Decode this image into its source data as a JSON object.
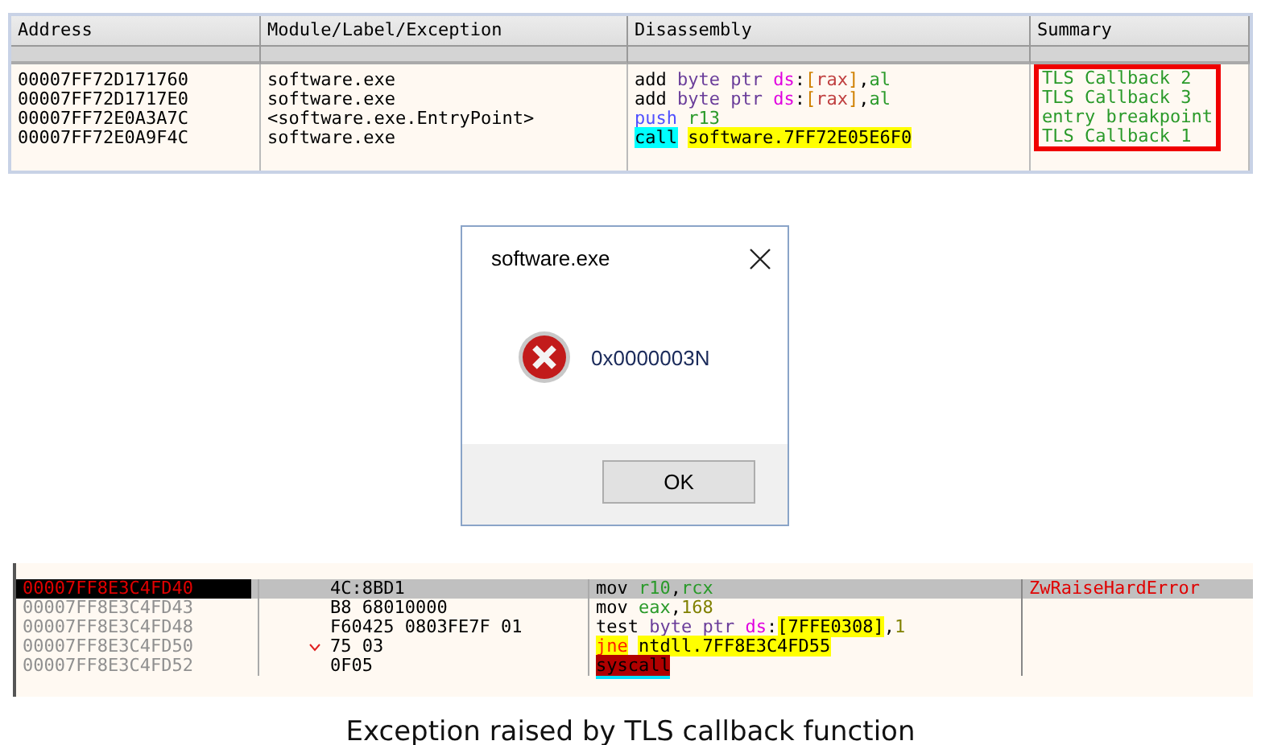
{
  "top_table": {
    "columns": [
      "Address",
      "Module/Label/Exception",
      "Disassembly",
      "Summary"
    ],
    "summary_highlighted": true,
    "rows": [
      {
        "address": "00007FF72D171760",
        "module": "software.exe",
        "disassembly": [
          {
            "text": "add ",
            "kind": "op"
          },
          {
            "text": "byte ptr ",
            "kind": "size"
          },
          {
            "text": "ds",
            "kind": "seg"
          },
          {
            "text": ":",
            "kind": "punct"
          },
          {
            "text": "[",
            "kind": "bracket"
          },
          {
            "text": "rax",
            "kind": "memreg"
          },
          {
            "text": "]",
            "kind": "bracket"
          },
          {
            "text": ",",
            "kind": "punct"
          },
          {
            "text": "al",
            "kind": "reg"
          }
        ],
        "summary": "TLS Callback 2"
      },
      {
        "address": "00007FF72D1717E0",
        "module": "software.exe",
        "disassembly": [
          {
            "text": "add ",
            "kind": "op"
          },
          {
            "text": "byte ptr ",
            "kind": "size"
          },
          {
            "text": "ds",
            "kind": "seg"
          },
          {
            "text": ":",
            "kind": "punct"
          },
          {
            "text": "[",
            "kind": "bracket"
          },
          {
            "text": "rax",
            "kind": "memreg"
          },
          {
            "text": "]",
            "kind": "bracket"
          },
          {
            "text": ",",
            "kind": "punct"
          },
          {
            "text": "al",
            "kind": "reg"
          }
        ],
        "summary": "TLS Callback 3"
      },
      {
        "address": "00007FF72E0A3A7C",
        "module": "<software.exe.EntryPoint>",
        "disassembly": [
          {
            "text": "push ",
            "kind": "stack"
          },
          {
            "text": "r13",
            "kind": "reg"
          }
        ],
        "summary": "entry breakpoint"
      },
      {
        "address": "00007FF72E0A9F4C",
        "module": "software.exe",
        "disassembly": [
          {
            "text": "call",
            "kind": "call"
          },
          {
            "text": "software.7FF72E05E6F0",
            "kind": "target"
          }
        ],
        "summary": "TLS Callback 1"
      }
    ]
  },
  "dialog": {
    "title": "software.exe",
    "message": "0x0000003N",
    "button": "OK"
  },
  "trace": {
    "rows": [
      {
        "address": "00007FF8E3C4FD40",
        "selected": true,
        "branch": false,
        "bytes": "4C:8BD1",
        "disassembly": [
          {
            "text": "mov ",
            "kind": "op"
          },
          {
            "text": "r10",
            "kind": "reg"
          },
          {
            "text": ",",
            "kind": "punct"
          },
          {
            "text": "rcx",
            "kind": "reg"
          }
        ],
        "comment": "ZwRaiseHardError"
      },
      {
        "address": "00007FF8E3C4FD43",
        "selected": false,
        "branch": false,
        "bytes": "B8 68010000",
        "disassembly": [
          {
            "text": "mov ",
            "kind": "op"
          },
          {
            "text": "eax",
            "kind": "reg"
          },
          {
            "text": ",",
            "kind": "punct"
          },
          {
            "text": "168",
            "kind": "imm"
          }
        ]
      },
      {
        "address": "00007FF8E3C4FD48",
        "selected": false,
        "branch": false,
        "bytes": "F60425 0803FE7F 01",
        "disassembly": [
          {
            "text": "test ",
            "kind": "op"
          },
          {
            "text": "byte ptr ",
            "kind": "size"
          },
          {
            "text": "ds",
            "kind": "seg"
          },
          {
            "text": ":",
            "kind": "punct"
          },
          {
            "text": "[7FFE0308]",
            "kind": "target"
          },
          {
            "text": ",",
            "kind": "punct"
          },
          {
            "text": "1",
            "kind": "imm"
          }
        ]
      },
      {
        "address": "00007FF8E3C4FD50",
        "selected": false,
        "branch": true,
        "bytes": "75 03",
        "disassembly": [
          {
            "text": "jne",
            "kind": "jump"
          },
          {
            "text": "ntdll.7FF8E3C4FD55",
            "kind": "target"
          }
        ]
      },
      {
        "address": "00007FF8E3C4FD52",
        "selected": false,
        "branch": false,
        "bytes": "0F05",
        "disassembly": [
          {
            "text": "syscall",
            "kind": "syscall"
          }
        ]
      }
    ]
  },
  "caption": "Exception raised by TLS callback function"
}
